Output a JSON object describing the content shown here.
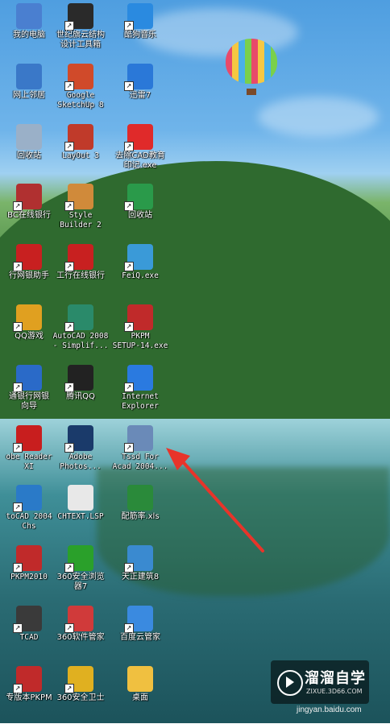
{
  "desktop": {
    "icons": [
      {
        "label": "我的电脑",
        "icon": "my-computer-icon",
        "color": "#4a7fd0",
        "col": 0,
        "row": 0,
        "mono": false,
        "shortcut": false
      },
      {
        "label": "世纪旗云结构\n设计工具箱",
        "icon": "toolbox-app-icon",
        "color": "#2a2a2a",
        "col": 1,
        "row": 0,
        "mono": false,
        "shortcut": true
      },
      {
        "label": "酷狗音乐",
        "icon": "kugou-music-icon",
        "color": "#2a8ae0",
        "col": 2,
        "row": 0,
        "mono": false,
        "shortcut": true
      },
      {
        "label": "网上邻居",
        "icon": "network-places-icon",
        "color": "#3a78c8",
        "col": 0,
        "row": 1,
        "mono": false,
        "shortcut": false
      },
      {
        "label": "Google\nSketchUp 8",
        "icon": "sketchup-icon",
        "color": "#d04a2a",
        "col": 1,
        "row": 1,
        "mono": true,
        "shortcut": true
      },
      {
        "label": "迅雷7",
        "icon": "xunlei-icon",
        "color": "#2a78d8",
        "col": 2,
        "row": 1,
        "mono": false,
        "shortcut": true
      },
      {
        "label": "回收站",
        "icon": "recycle-bin-icon",
        "color": "#9ab0c8",
        "col": 0,
        "row": 2,
        "mono": false,
        "shortcut": false
      },
      {
        "label": "LayOut 3",
        "icon": "layout-icon",
        "color": "#c03a2a",
        "col": 1,
        "row": 2,
        "mono": true,
        "shortcut": true
      },
      {
        "label": "去除CAD教育\n印记.exe",
        "icon": "cad-tool-icon",
        "color": "#e02a2a",
        "col": 2,
        "row": 2,
        "mono": false,
        "shortcut": true
      },
      {
        "label": "BC在线银行",
        "icon": "bank-bc-icon",
        "color": "#b03030",
        "col": 0,
        "row": 3,
        "mono": false,
        "shortcut": true
      },
      {
        "label": "Style\nBuilder 2",
        "icon": "style-builder-icon",
        "color": "#d08a3a",
        "col": 1,
        "row": 3,
        "mono": true,
        "shortcut": true
      },
      {
        "label": "回收站",
        "icon": "globe-recycle-icon",
        "color": "#2a9a4a",
        "col": 2,
        "row": 3,
        "mono": false,
        "shortcut": true
      },
      {
        "label": "行网银助手",
        "icon": "icbc-assistant-icon",
        "color": "#c82020",
        "col": 0,
        "row": 4,
        "mono": false,
        "shortcut": true
      },
      {
        "label": "工行在线银行",
        "icon": "icbc-bank-icon",
        "color": "#c82020",
        "col": 1,
        "row": 4,
        "mono": false,
        "shortcut": true
      },
      {
        "label": "FeiQ.exe",
        "icon": "feiq-icon",
        "color": "#3a9ad8",
        "col": 2,
        "row": 4,
        "mono": true,
        "shortcut": true
      },
      {
        "label": "QQ游戏",
        "icon": "qq-game-icon",
        "color": "#e0a020",
        "col": 0,
        "row": 5,
        "mono": false,
        "shortcut": true
      },
      {
        "label": "AutoCAD 2008\n- Simplif...",
        "icon": "autocad-2008-icon",
        "color": "#2a8a6a",
        "col": 1,
        "row": 5,
        "mono": true,
        "shortcut": true
      },
      {
        "label": "PKPM\nSETUP-14.exe",
        "icon": "pkpm-setup-icon",
        "color": "#c02a2a",
        "col": 2,
        "row": 5,
        "mono": true,
        "shortcut": true
      },
      {
        "label": "通银行网银\n向导",
        "icon": "bank-wizard-icon",
        "color": "#2a6ac8",
        "col": 0,
        "row": 6,
        "mono": false,
        "shortcut": true
      },
      {
        "label": "腾讯QQ",
        "icon": "qq-icon",
        "color": "#222222",
        "col": 1,
        "row": 6,
        "mono": false,
        "shortcut": true
      },
      {
        "label": "Internet\nExplorer",
        "icon": "internet-explorer-icon",
        "color": "#2a7ae0",
        "col": 2,
        "row": 6,
        "mono": true,
        "shortcut": true
      },
      {
        "label": "obe Reader\nXI",
        "icon": "adobe-reader-icon",
        "color": "#c81e1e",
        "col": 0,
        "row": 7,
        "mono": true,
        "shortcut": true
      },
      {
        "label": "Adobe\nPhotos...",
        "icon": "photoshop-icon",
        "color": "#1a3a6a",
        "col": 1,
        "row": 7,
        "mono": true,
        "shortcut": true
      },
      {
        "label": "Tssd For\nAcad 2004...",
        "icon": "tssd-icon",
        "color": "#6a8ab8",
        "col": 2,
        "row": 7,
        "mono": true,
        "shortcut": true
      },
      {
        "label": "toCAD 2004\nChs",
        "icon": "autocad-2004-icon",
        "color": "#2a7ac8",
        "col": 0,
        "row": 8,
        "mono": true,
        "shortcut": true
      },
      {
        "label": "CHTEXT.LSP",
        "icon": "lsp-file-icon",
        "color": "#e8e8e8",
        "col": 1,
        "row": 8,
        "mono": true,
        "shortcut": false
      },
      {
        "label": "配筋率.xls",
        "icon": "excel-file-icon",
        "color": "#2a8a3a",
        "col": 2,
        "row": 8,
        "mono": false,
        "shortcut": false
      },
      {
        "label": "PKPM2010",
        "icon": "pkpm2010-icon",
        "color": "#c02a2a",
        "col": 0,
        "row": 9,
        "mono": true,
        "shortcut": true
      },
      {
        "label": "360安全浏览\n器7",
        "icon": "360-browser-icon",
        "color": "#2aa02a",
        "col": 1,
        "row": 9,
        "mono": false,
        "shortcut": true
      },
      {
        "label": "天正建筑8",
        "icon": "tangent-arch-icon",
        "color": "#3a8ad0",
        "col": 2,
        "row": 9,
        "mono": false,
        "shortcut": true
      },
      {
        "label": "TCAD",
        "icon": "tcad-icon",
        "color": "#3a3a3a",
        "col": 0,
        "row": 10,
        "mono": true,
        "shortcut": true
      },
      {
        "label": "360软件管家",
        "icon": "360-manager-icon",
        "color": "#d03a3a",
        "col": 1,
        "row": 10,
        "mono": false,
        "shortcut": true
      },
      {
        "label": "百度云管家",
        "icon": "baidu-cloud-icon",
        "color": "#3a8ae0",
        "col": 2,
        "row": 10,
        "mono": false,
        "shortcut": true
      },
      {
        "label": "专版本PKPM",
        "icon": "pkpm-pro-icon",
        "color": "#c02a2a",
        "col": 0,
        "row": 11,
        "mono": false,
        "shortcut": true
      },
      {
        "label": "360安全卫士",
        "icon": "360-guard-icon",
        "color": "#e0b020",
        "col": 1,
        "row": 11,
        "mono": false,
        "shortcut": true
      },
      {
        "label": "桌面",
        "icon": "folder-icon",
        "color": "#f0c040",
        "col": 2,
        "row": 11,
        "mono": false,
        "shortcut": false
      }
    ]
  },
  "watermark": {
    "brand": "溜溜自学",
    "site": "ZIXUE.3D66.COM"
  },
  "footer": {
    "text": "jingyan.baidu.com"
  },
  "colors": {
    "arrow": "#e8342a",
    "label_text": "#ffffff"
  }
}
